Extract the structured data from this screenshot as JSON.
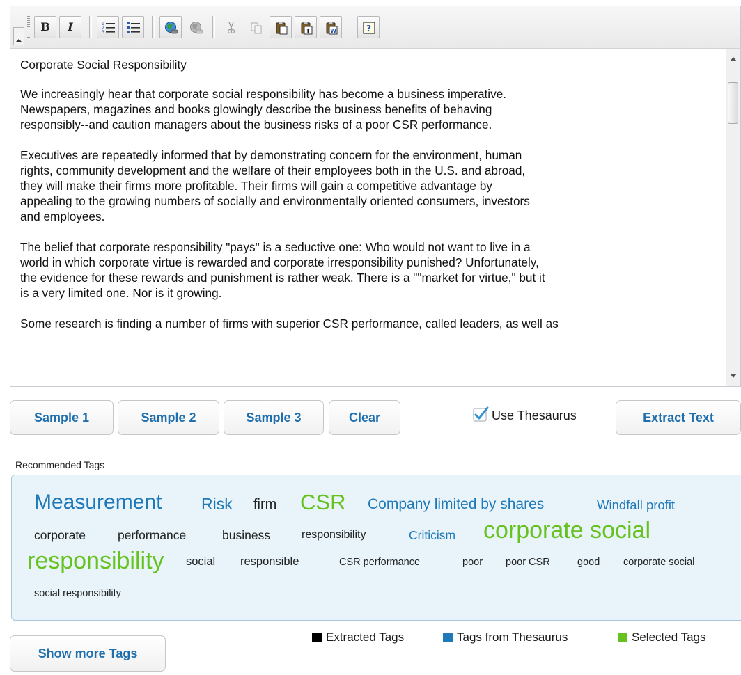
{
  "toolbar": {
    "buttons": [
      {
        "name": "bold-button",
        "glyph": "B"
      },
      {
        "name": "italic-button",
        "glyph": "I"
      }
    ]
  },
  "editor": {
    "paragraphs": [
      "Corporate Social Responsibility",
      "We increasingly hear that corporate social responsibility has become a business imperative.\nNewspapers, magazines and books glowingly describe the business benefits of behaving\nresponsibly--and caution managers about the business risks of a poor CSR performance.",
      "Executives are repeatedly informed that by demonstrating concern for the environment, human\nrights, community development and the welfare of their employees both in the U.S. and abroad,\nthey will make their firms more profitable. Their firms will gain a competitive advantage by\nappealing to the growing numbers of socially and environmentally oriented consumers, investors\nand employees.",
      "The belief that corporate responsibility \"pays\" is a seductive one: Who would not want to live in a\nworld in which corporate virtue is rewarded and corporate irresponsibility punished? Unfortunately,\nthe evidence for these rewards and punishment is rather weak. There is a \"\"market for virtue,\" but it\nis a very limited one. Nor is it growing.",
      "Some research is finding a number of firms with superior CSR performance, called leaders, as well as"
    ]
  },
  "actions": {
    "sample1": "Sample 1",
    "sample2": "Sample 2",
    "sample3": "Sample 3",
    "clear": "Clear",
    "use_thesaurus_label": "Use Thesaurus",
    "use_thesaurus_checked": true,
    "extract": "Extract Text"
  },
  "recommended": {
    "label": "Recommended Tags",
    "tags": [
      "Measurement",
      "Risk",
      "firm",
      "CSR",
      "Company limited by shares",
      "Windfall profit",
      "corporate",
      "performance",
      "business",
      "responsibility",
      "Criticism",
      "corporate social",
      "responsibility",
      "social",
      "responsible",
      "CSR performance",
      "poor",
      "poor CSR",
      "good",
      "corporate social",
      "social responsibility"
    ]
  },
  "legend": {
    "extracted": "Extracted Tags",
    "thesaurus": "Tags from Thesaurus",
    "selected": "Selected Tags",
    "colors": {
      "extracted": "#000000",
      "thesaurus": "#1f79b8",
      "selected": "#66c21f"
    }
  },
  "show_more": "Show more Tags"
}
